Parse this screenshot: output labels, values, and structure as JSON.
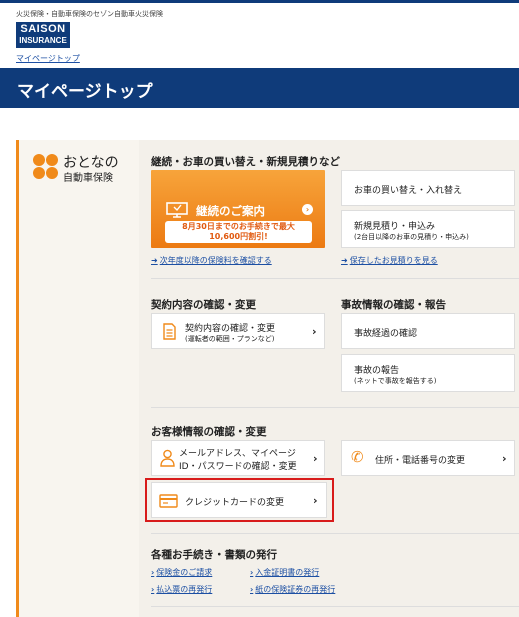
{
  "header": {
    "tagline": "火災保険・自動車保険のセゾン自動車火災保険",
    "logo_line1": "SAISON",
    "logo_line2": "INSURANCE",
    "breadcrumb": "マイページトップ",
    "page_title": "マイページトップ"
  },
  "brand": {
    "line1": "おとなの",
    "line2": "自動車保険"
  },
  "renewal": {
    "heading": "継続・お車の買い替え・新規見積りなど",
    "button_label": "継続のご案内",
    "promo_line1": "8月30日までのお手続きで最大",
    "promo_line2": "10,600円割引!",
    "car_change": "お車の買い替え・入れ替え",
    "new_quote": "新規見積り・申込み",
    "new_quote_sub": "(2台目以降のお車の見積り・申込み)",
    "link_next_year": "次年度以降の保険料を確認する",
    "link_saved": "保存したお見積りを見る"
  },
  "contract": {
    "heading": "契約内容の確認・変更",
    "card_title": "契約内容の確認・変更",
    "card_sub": "(運転者の範囲・プランなど)"
  },
  "accident": {
    "heading": "事故情報の確認・報告",
    "progress": "事故経過の確認",
    "report": "事故の報告",
    "report_sub": "(ネットで事故を報告する)"
  },
  "customer": {
    "heading": "お客様情報の確認・変更",
    "mail_line1": "メールアドレス、マイページ",
    "mail_line2": "ID・パスワードの確認・変更",
    "address": "住所・電話番号の変更",
    "credit": "クレジットカードの変更"
  },
  "procedures": {
    "heading": "各種お手続き・書類の発行",
    "claim": "保険金のご請求",
    "deposit": "入金証明書の発行",
    "payslip": "払込票の再発行",
    "paper_cert": "紙の保険証券の再発行"
  },
  "colors": {
    "navy": "#0f3b7a",
    "orange": "#f08a1a",
    "highlight": "#d81b1b",
    "link": "#1c4fa3"
  }
}
